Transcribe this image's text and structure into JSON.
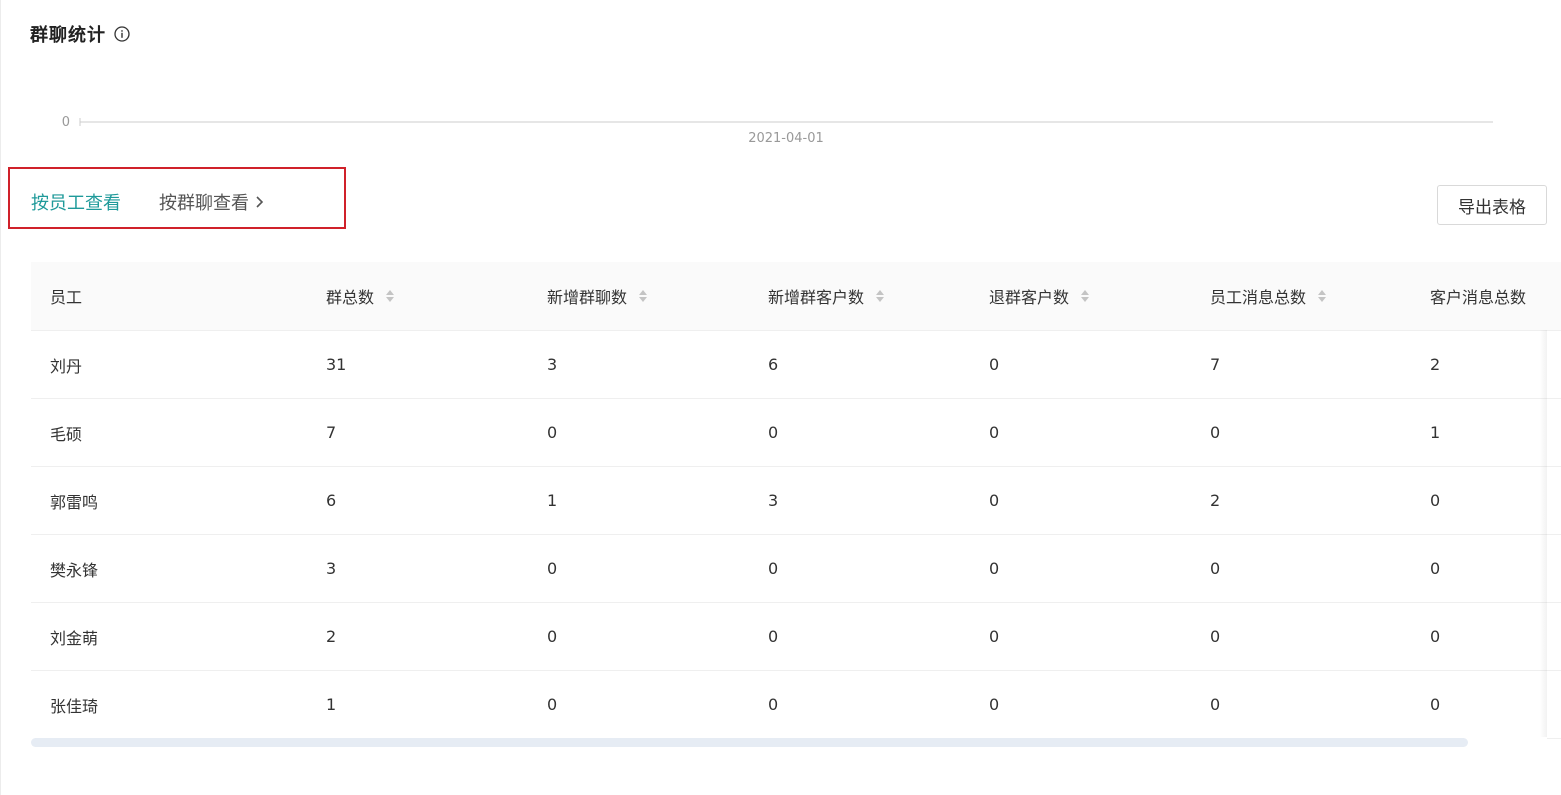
{
  "header": {
    "title": "群聊统计",
    "info_icon": "info-circle-icon"
  },
  "mini_chart": {
    "y_tick": "0",
    "x_tick": "2021-04-01",
    "colors": {
      "axis": "#cccccc",
      "tick_text": "#999999"
    }
  },
  "view_tabs": {
    "by_employee": "按员工查看",
    "by_group": "按群聊查看",
    "chevron_icon": "chevron-right-icon",
    "active_color": "#1f9a9a",
    "highlight_color": "#d0212a"
  },
  "toolbar": {
    "export_label": "导出表格"
  },
  "table": {
    "columns": [
      {
        "label": "员工",
        "sortable": false
      },
      {
        "label": "群总数",
        "sortable": true
      },
      {
        "label": "新增群聊数",
        "sortable": true
      },
      {
        "label": "新增群客户数",
        "sortable": true
      },
      {
        "label": "退群客户数",
        "sortable": true
      },
      {
        "label": "员工消息总数",
        "sortable": true
      },
      {
        "label": "客户消息总数",
        "sortable": false
      }
    ],
    "rows": [
      [
        "刘丹",
        "31",
        "3",
        "6",
        "0",
        "7",
        "2"
      ],
      [
        "毛硕",
        "7",
        "0",
        "0",
        "0",
        "0",
        "1"
      ],
      [
        "郭雷鸣",
        "6",
        "1",
        "3",
        "0",
        "2",
        "0"
      ],
      [
        "樊永锋",
        "3",
        "0",
        "0",
        "0",
        "0",
        "0"
      ],
      [
        "刘金萌",
        "2",
        "0",
        "0",
        "0",
        "0",
        "0"
      ],
      [
        "张佳琦",
        "1",
        "0",
        "0",
        "0",
        "0",
        "0"
      ]
    ]
  }
}
